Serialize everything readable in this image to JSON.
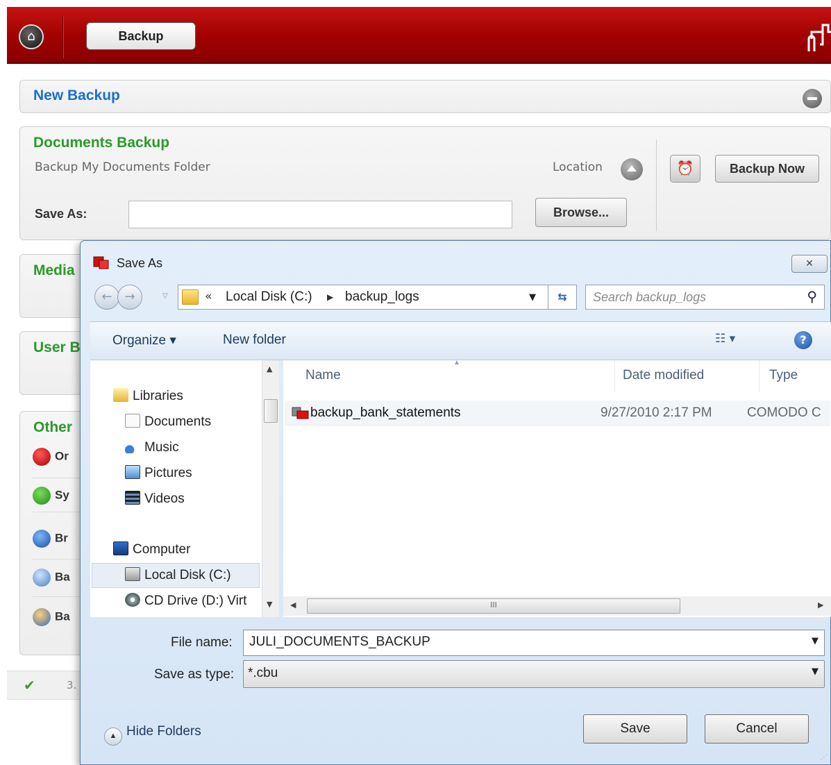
{
  "app": {
    "tab_label": "Backup",
    "new_backup_title": "New Backup",
    "documents_panel": {
      "title": "Documents Backup",
      "subtitle": "Backup My Documents Folder",
      "location_label": "Location",
      "backup_now_label": "Backup Now",
      "save_as_label": "Save As:",
      "save_as_value": "",
      "browse_label": "Browse..."
    },
    "media_title": "Media",
    "user_title": "User B",
    "other_title": "Other",
    "other_items": [
      "Or",
      "Sy",
      "Br",
      "Ba",
      "Ba"
    ],
    "status_version": "3."
  },
  "dialog": {
    "title": "Save As",
    "close_label": "✕",
    "address": {
      "chevron": "«",
      "segments": [
        "Local Disk (C:)",
        "backup_logs"
      ]
    },
    "search_placeholder": "Search backup_logs",
    "toolbar": {
      "organize": "Organize ▾",
      "new_folder": "New folder",
      "help": "?"
    },
    "nav": {
      "libraries": "Libraries",
      "documents": "Documents",
      "music": "Music",
      "pictures": "Pictures",
      "videos": "Videos",
      "computer": "Computer",
      "local_disk": "Local Disk (C:)",
      "cd_drive": "CD Drive (D:) Virt"
    },
    "columns": {
      "name": "Name",
      "date": "Date modified",
      "type": "Type"
    },
    "files": [
      {
        "name": "backup_bank_statements",
        "date": "9/27/2010 2:17 PM",
        "type": "COMODO C"
      }
    ],
    "scroll_grip": "III",
    "file_name_label": "File name:",
    "file_name_value": "JULI_DOCUMENTS_BACKUP",
    "save_type_label": "Save as type:",
    "save_type_value": "*.cbu",
    "hide_folders": "Hide Folders",
    "save_label": "Save",
    "cancel_label": "Cancel"
  },
  "colors": {
    "brand_red": "#a00000",
    "title_blue": "#1a6fd0",
    "title_green": "#2a9a2a"
  }
}
